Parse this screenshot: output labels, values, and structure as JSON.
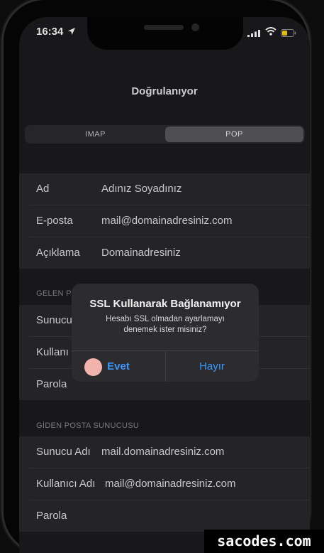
{
  "status_bar": {
    "time": "16:34"
  },
  "navigation": {
    "title": "Doğrulanıyor"
  },
  "segment": {
    "options": [
      "IMAP",
      "POP"
    ],
    "selected": "POP"
  },
  "account": {
    "rows": [
      {
        "label": "Ad",
        "value": "Adınız Soyadınız"
      },
      {
        "label": "E-posta",
        "value": "mail@domainadresiniz.com"
      },
      {
        "label": "Açıklama",
        "value": "Domainadresiniz"
      }
    ]
  },
  "incoming": {
    "header": "GELEN P",
    "rows": [
      {
        "label": "Sunucu"
      },
      {
        "label": "Kullanı"
      },
      {
        "label": "Parola"
      }
    ]
  },
  "outgoing": {
    "header": "GİDEN POSTA SUNUCUSU",
    "rows": [
      {
        "label": "Sunucu Adı",
        "value": "mail.domainadresiniz.com"
      },
      {
        "label": "Kullanıcı Adı",
        "value": "mail@domainadresiniz.com"
      },
      {
        "label": "Parola",
        "value": ""
      }
    ]
  },
  "alert": {
    "title": "SSL Kullanarak Bağlanamıyor",
    "message_line1": "Hesabı SSL olmadan ayarlamayı",
    "message_line2": "denemek ister misiniz?",
    "yes_label": "Evet",
    "no_label": "Hayır"
  },
  "watermark": "sacodes.com",
  "colors": {
    "accent": "#3a96ff",
    "battery": "#ffd60a",
    "background": "#1c1c1e",
    "cell": "#2a2a2c"
  },
  "icons": [
    "location-arrow-icon",
    "signal-icon",
    "wifi-icon",
    "battery-icon"
  ]
}
